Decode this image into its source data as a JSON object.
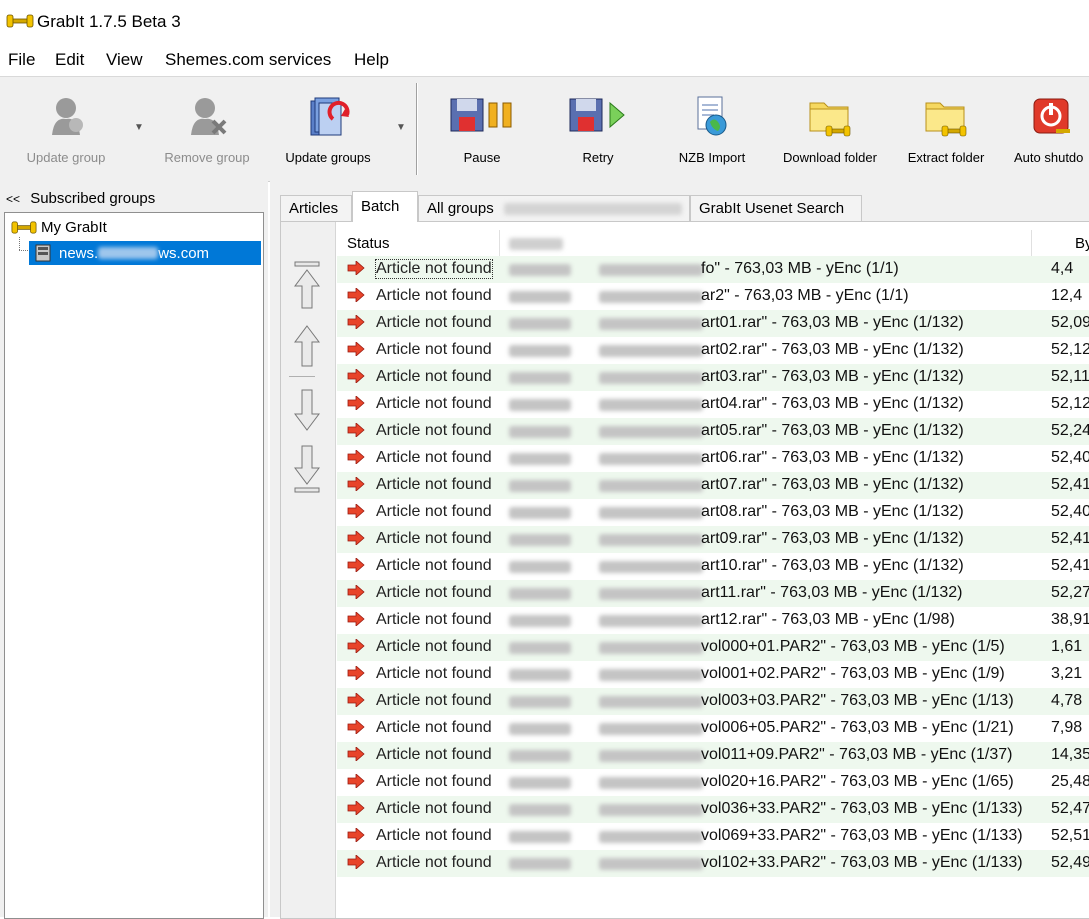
{
  "window": {
    "title": "GrabIt 1.7.5 Beta 3"
  },
  "menu": [
    "File",
    "Edit",
    "View",
    "Shemes.com services",
    "Help"
  ],
  "toolbar": {
    "update_group": "Update group",
    "remove_group": "Remove group",
    "update_groups": "Update groups",
    "pause": "Pause",
    "retry": "Retry",
    "nzb_import": "NZB Import",
    "download_folder": "Download folder",
    "extract_folder": "Extract folder",
    "auto_shutdown": "Auto shutdo"
  },
  "left": {
    "header": "Subscribed groups",
    "collapse": "<<",
    "root": "My GrabIt",
    "server_prefix": "news.",
    "server_suffix": "ws.com"
  },
  "tabs": [
    "Articles",
    "Batch",
    "All groups",
    "GrabIt Usenet Search"
  ],
  "active_tab": "Batch",
  "grid": {
    "col_status": "Status",
    "col_bytes": "By",
    "rows": [
      {
        "status": "Article not found",
        "subject": "fo\" - 763,03 MB - yEnc (1/1)",
        "bytes": "4,4"
      },
      {
        "status": "Article not found",
        "subject": "ar2\" - 763,03 MB - yEnc (1/1)",
        "bytes": "12,4"
      },
      {
        "status": "Article not found",
        "subject": "art01.rar\" - 763,03 MB - yEnc (1/132)",
        "bytes": "52,09"
      },
      {
        "status": "Article not found",
        "subject": "art02.rar\" - 763,03 MB - yEnc (1/132)",
        "bytes": "52,12"
      },
      {
        "status": "Article not found",
        "subject": "art03.rar\" - 763,03 MB - yEnc (1/132)",
        "bytes": "52,11"
      },
      {
        "status": "Article not found",
        "subject": "art04.rar\" - 763,03 MB - yEnc (1/132)",
        "bytes": "52,12"
      },
      {
        "status": "Article not found",
        "subject": "art05.rar\" - 763,03 MB - yEnc (1/132)",
        "bytes": "52,24"
      },
      {
        "status": "Article not found",
        "subject": "art06.rar\" - 763,03 MB - yEnc (1/132)",
        "bytes": "52,40"
      },
      {
        "status": "Article not found",
        "subject": "art07.rar\" - 763,03 MB - yEnc (1/132)",
        "bytes": "52,41"
      },
      {
        "status": "Article not found",
        "subject": "art08.rar\" - 763,03 MB - yEnc (1/132)",
        "bytes": "52,40"
      },
      {
        "status": "Article not found",
        "subject": "art09.rar\" - 763,03 MB - yEnc (1/132)",
        "bytes": "52,41"
      },
      {
        "status": "Article not found",
        "subject": "art10.rar\" - 763,03 MB - yEnc (1/132)",
        "bytes": "52,41"
      },
      {
        "status": "Article not found",
        "subject": "art11.rar\" - 763,03 MB - yEnc (1/132)",
        "bytes": "52,27"
      },
      {
        "status": "Article not found",
        "subject": "art12.rar\" - 763,03 MB - yEnc (1/98)",
        "bytes": "38,91"
      },
      {
        "status": "Article not found",
        "subject": "vol000+01.PAR2\" - 763,03 MB - yEnc (1/5)",
        "bytes": "1,61"
      },
      {
        "status": "Article not found",
        "subject": "vol001+02.PAR2\" - 763,03 MB - yEnc (1/9)",
        "bytes": "3,21"
      },
      {
        "status": "Article not found",
        "subject": "vol003+03.PAR2\" - 763,03 MB - yEnc (1/13)",
        "bytes": "4,78"
      },
      {
        "status": "Article not found",
        "subject": "vol006+05.PAR2\" - 763,03 MB - yEnc (1/21)",
        "bytes": "7,98"
      },
      {
        "status": "Article not found",
        "subject": "vol011+09.PAR2\" - 763,03 MB - yEnc (1/37)",
        "bytes": "14,35"
      },
      {
        "status": "Article not found",
        "subject": "vol020+16.PAR2\" - 763,03 MB - yEnc (1/65)",
        "bytes": "25,48"
      },
      {
        "status": "Article not found",
        "subject": "vol036+33.PAR2\" - 763,03 MB - yEnc (1/133)",
        "bytes": "52,47"
      },
      {
        "status": "Article not found",
        "subject": "vol069+33.PAR2\" - 763,03 MB - yEnc (1/133)",
        "bytes": "52,51"
      },
      {
        "status": "Article not found",
        "subject": "vol102+33.PAR2\" - 763,03 MB - yEnc (1/133)",
        "bytes": "52,49"
      }
    ]
  },
  "colors": {
    "selection": "#0078d7",
    "row_alt": "#eef8ee",
    "status_arrow": "#e8442a"
  }
}
